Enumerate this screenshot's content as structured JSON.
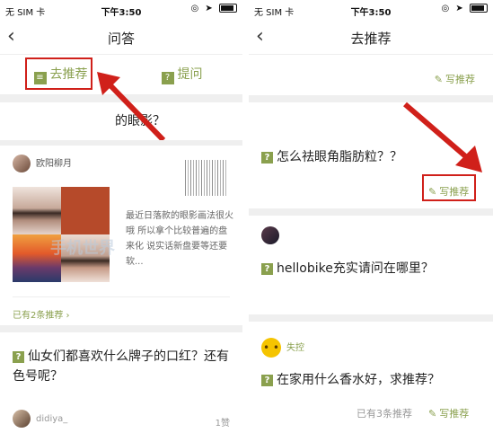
{
  "left": {
    "status": {
      "carrier": "无 SIM 卡",
      "time": "下午3:50"
    },
    "nav": {
      "back": "‹",
      "title": "问答"
    },
    "tabs": [
      {
        "label": "去推荐",
        "icon": "list-icon"
      },
      {
        "label": "提问",
        "icon": "question-icon"
      }
    ],
    "partial_question": "的眼影？",
    "card1": {
      "user": "欧阳柳月",
      "answer": "最近日落款的眼影画法很火哦 所以拿个比较普遍的盘来化 说实话新盘要等还要软...",
      "recommend_count": "已有2条推荐 ›"
    },
    "card2": {
      "question": "仙女们都喜欢什么牌子的口红？还有色号呢？",
      "user": "didiya_",
      "likes": "1赞"
    },
    "watermark": "手机世界"
  },
  "right": {
    "status": {
      "carrier": "无 SIM 卡",
      "time": "下午3:50"
    },
    "nav": {
      "back": "‹",
      "title": "去推荐"
    },
    "write_label": "写推荐",
    "card1": {
      "question": "怎么祛眼角脂肪粒？？",
      "write_label": "写推荐"
    },
    "card2": {
      "question": "hellobike充实请问在哪里？"
    },
    "card3": {
      "user": "失控",
      "question": "在家用什么香水好，求推荐？",
      "recommend_count": "已有3条推荐",
      "write_label": "写推荐"
    }
  },
  "colors": {
    "accent": "#8aa04e",
    "highlight": "#d0201a",
    "separator": "#efefef"
  }
}
